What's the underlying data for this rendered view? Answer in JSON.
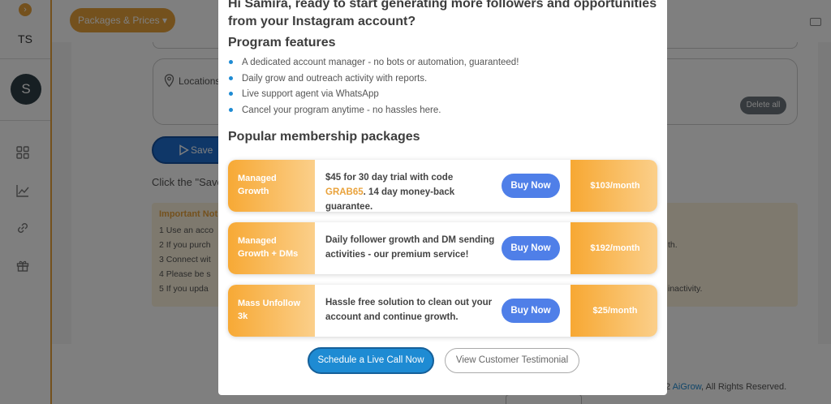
{
  "sidebar": {
    "toggle_icon": "chevron-right-icon",
    "initials": "TS",
    "avatar_letter": "S",
    "nav_icons": [
      "grid-icon",
      "chart-icon",
      "link-icon",
      "gift-icon"
    ]
  },
  "topbar": {
    "packages_label": "Packages & Prices ▾",
    "video_icon": "video-camera-icon"
  },
  "background_page": {
    "locations_label": "Locations",
    "delete_all_label": "Delete all",
    "save_label": "Save",
    "click_text": "Click the \"Save",
    "notes_title": "Important Not",
    "notes_left": [
      "1  Use an acco",
      "2  If you purch",
      "3  Connect wit",
      "4  Please be s",
      "5  If you upda"
    ],
    "notes_right": [
      "th.",
      "inactivity."
    ],
    "footer_prefix": "2",
    "footer_brand": "AiGrow",
    "footer_suffix": ", All Rights Reserved."
  },
  "modal": {
    "headline": "Hi Samira, ready to start generating more followers and opportunities from your Instagram account?",
    "features_title": "Program features",
    "features": [
      "A dedicated account manager - no bots or automation, guaranteed!",
      "Daily grow and outreach activity with reports.",
      "Live support agent via WhatsApp",
      "Cancel your program anytime - no hassles here."
    ],
    "packages_title": "Popular membership packages",
    "packages": [
      {
        "name": "Managed Growth",
        "desc_before": "$45 for 30 day trial with code ",
        "desc_code": "GRAB65",
        "desc_after": ". 14 day money-back guarantee.",
        "buy_label": "Buy Now",
        "price": "$103/month"
      },
      {
        "name": "Managed Growth + DMs",
        "desc_before": "Daily follower growth and DM sending activities - our premium service!",
        "desc_code": "",
        "desc_after": "",
        "buy_label": "Buy Now",
        "price": "$192/month"
      },
      {
        "name": "Mass Unfollow 3k",
        "desc_before": "Hassle free solution to clean out your account and continue growth.",
        "desc_code": "",
        "desc_after": "",
        "buy_label": "Buy Now",
        "price": "$25/month"
      }
    ],
    "schedule_label": "Schedule a Live Call Now",
    "testimonial_label": "View Customer Testimonial"
  },
  "colors": {
    "brand_orange": "#e9a23b",
    "buy_blue": "#4f7fe8",
    "call_blue": "#1e8bd3"
  }
}
